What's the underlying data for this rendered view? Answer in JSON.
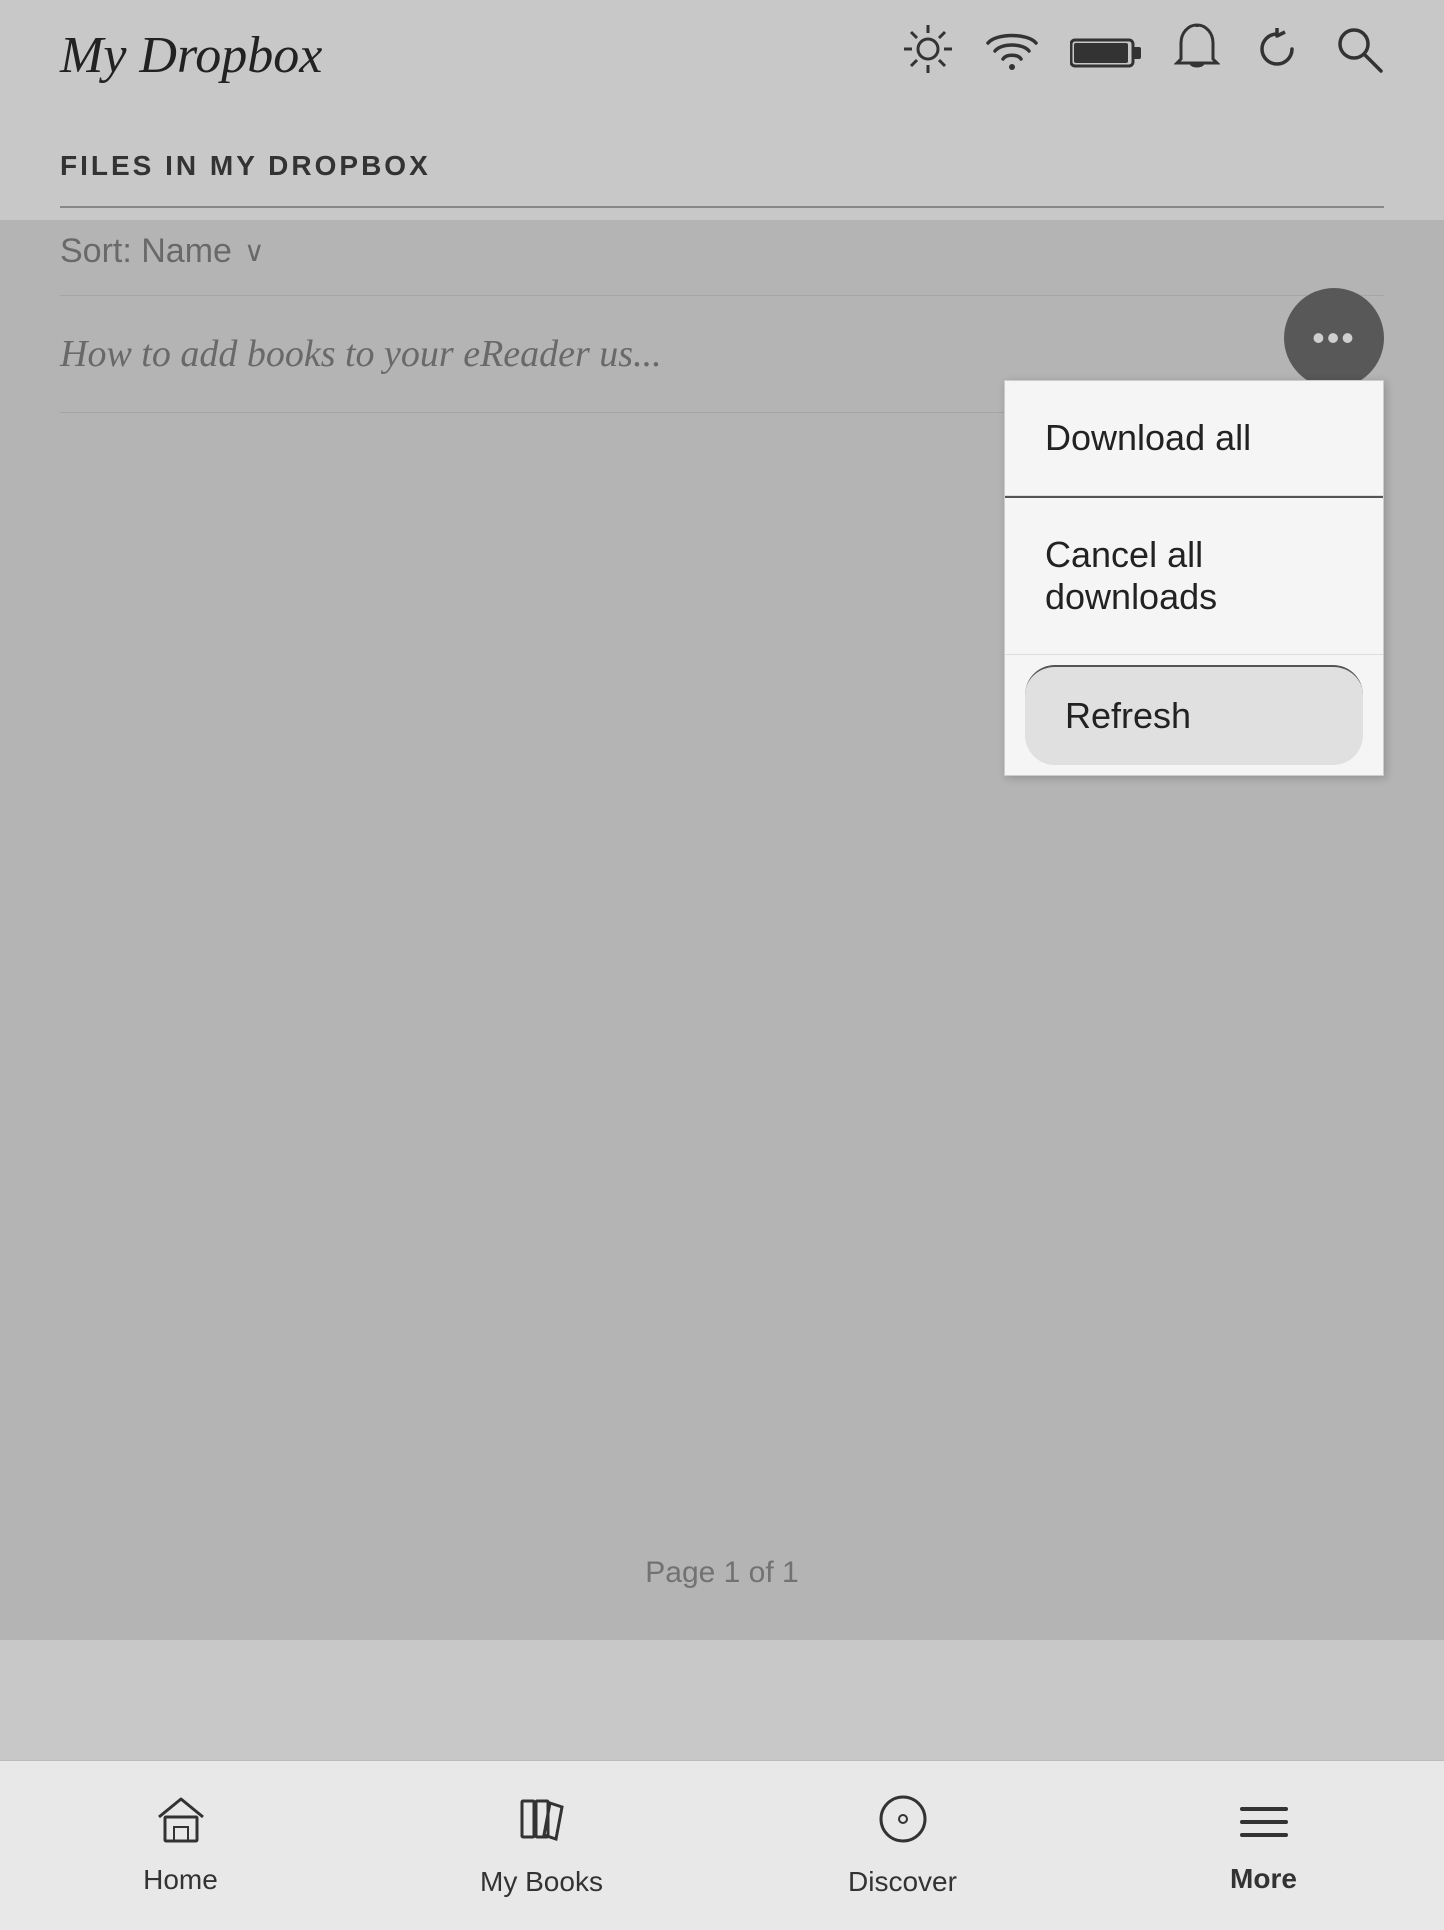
{
  "header": {
    "title": "My Dropbox",
    "icons": {
      "brightness": "☀",
      "wifi": "wifi-icon",
      "battery": "battery-icon",
      "notification": "🔔",
      "sync": "sync-icon",
      "search": "🔍"
    }
  },
  "section": {
    "title": "FILES IN MY DROPBOX",
    "sort_label": "Sort: Name",
    "sort_chevron": "∨"
  },
  "file_list": [
    {
      "title": "How to add books to your eReader us..."
    }
  ],
  "dropdown": {
    "items": [
      {
        "label": "Download all",
        "style": "normal"
      },
      {
        "label": "Cancel all downloads",
        "style": "normal"
      },
      {
        "label": "Refresh",
        "style": "highlighted"
      }
    ]
  },
  "more_button": {
    "label": "•••"
  },
  "pagination": {
    "text": "Page 1 of 1"
  },
  "bottom_nav": {
    "items": [
      {
        "label": "Home",
        "icon": "⌂"
      },
      {
        "label": "My Books",
        "icon": "📚"
      },
      {
        "label": "Discover",
        "icon": "◎"
      },
      {
        "label": "More",
        "icon": "☰",
        "bold": true
      }
    ]
  }
}
